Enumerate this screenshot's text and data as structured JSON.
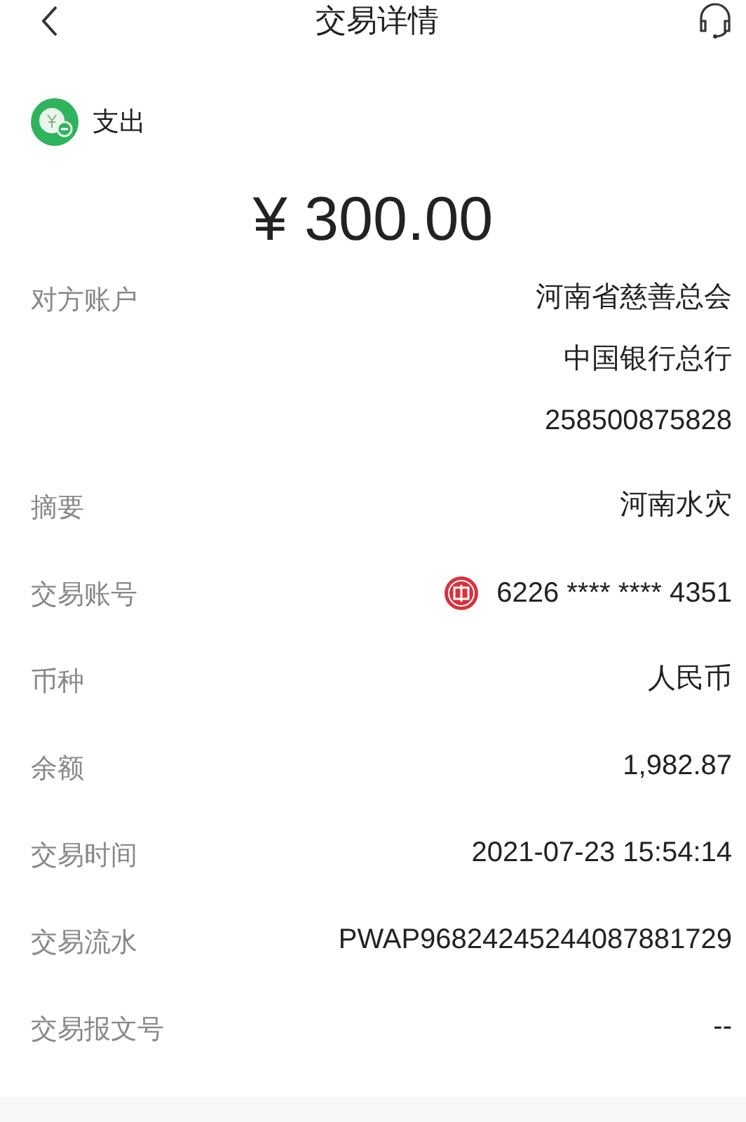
{
  "header": {
    "title": "交易详情"
  },
  "type": {
    "label": "支出"
  },
  "amount": "¥ 300.00",
  "rows": [
    {
      "kind": "text",
      "label": "对方账户",
      "values": [
        "河南省慈善总会",
        "中国银行总行",
        "258500875828"
      ]
    },
    {
      "kind": "text",
      "label": "摘要",
      "values": [
        "河南水灾"
      ]
    },
    {
      "kind": "card",
      "label": "交易账号",
      "values": [
        "6226 **** **** 4351"
      ]
    },
    {
      "kind": "text",
      "label": "币种",
      "values": [
        "人民币"
      ]
    },
    {
      "kind": "text",
      "label": "余额",
      "values": [
        "1,982.87"
      ]
    },
    {
      "kind": "text",
      "label": "交易时间",
      "values": [
        "2021-07-23 15:54:14"
      ]
    },
    {
      "kind": "text",
      "label": "交易流水",
      "values": [
        "PWAP96824245244087881729"
      ]
    },
    {
      "kind": "text",
      "label": "交易报文号",
      "values": [
        "--"
      ]
    }
  ]
}
